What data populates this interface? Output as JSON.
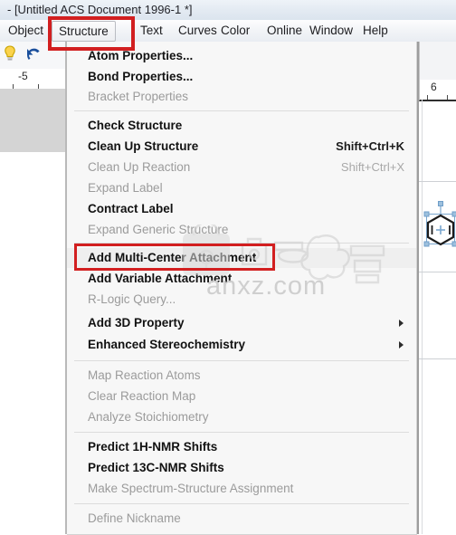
{
  "window": {
    "title": "- [Untitled ACS Document 1996-1 *]"
  },
  "menubar": {
    "items": [
      {
        "label": "Object",
        "active": false
      },
      {
        "label": "Structure",
        "active": true
      },
      {
        "label": "Text",
        "active": false
      },
      {
        "label": "Curves",
        "active": false
      },
      {
        "label": "Color",
        "active": false
      },
      {
        "label": "Online",
        "active": false
      },
      {
        "label": "Window",
        "active": false
      },
      {
        "label": "Help",
        "active": false
      }
    ]
  },
  "toolbar": {
    "lightbulb_icon": "lightbulb-icon",
    "undo_icon": "undo-icon"
  },
  "rulers": {
    "left_value": "-5",
    "right_value": "6"
  },
  "canvas": {
    "structure_name": "benzene-ring"
  },
  "dropdown": {
    "owner": "Structure",
    "items": [
      {
        "label": "Atom Properties...",
        "enabled": true,
        "accel": "",
        "submenu": false
      },
      {
        "label": "Bond Properties...",
        "enabled": true,
        "accel": "",
        "submenu": false
      },
      {
        "label": "Bracket Properties",
        "enabled": false,
        "accel": "",
        "submenu": false
      },
      {
        "separator": true
      },
      {
        "label": "Check Structure",
        "enabled": true,
        "accel": "",
        "submenu": false
      },
      {
        "label": "Clean Up Structure",
        "enabled": true,
        "accel": "Shift+Ctrl+K",
        "submenu": false
      },
      {
        "label": "Clean Up Reaction",
        "enabled": false,
        "accel": "Shift+Ctrl+X",
        "submenu": false
      },
      {
        "label": "Expand Label",
        "enabled": false,
        "accel": "",
        "submenu": false
      },
      {
        "label": "Contract Label",
        "enabled": true,
        "accel": "",
        "submenu": false
      },
      {
        "label": "Expand Generic Structure",
        "enabled": false,
        "accel": "",
        "submenu": false
      },
      {
        "separator": true
      },
      {
        "label": "Add Multi-Center Attachment",
        "enabled": true,
        "accel": "",
        "submenu": false,
        "highlighted": true
      },
      {
        "label": "Add Variable Attachment",
        "enabled": true,
        "accel": "",
        "submenu": false
      },
      {
        "label": "R-Logic Query...",
        "enabled": false,
        "accel": "",
        "submenu": false
      },
      {
        "label": "Add 3D Property",
        "enabled": true,
        "accel": "",
        "submenu": true
      },
      {
        "label": "Enhanced Stereochemistry",
        "enabled": true,
        "accel": "",
        "submenu": true
      },
      {
        "separator": true
      },
      {
        "label": "Map Reaction Atoms",
        "enabled": false,
        "accel": "",
        "submenu": false
      },
      {
        "label": "Clear Reaction Map",
        "enabled": false,
        "accel": "",
        "submenu": false
      },
      {
        "label": "Analyze Stoichiometry",
        "enabled": false,
        "accel": "",
        "submenu": false
      },
      {
        "separator": true
      },
      {
        "label": "Predict 1H-NMR Shifts",
        "enabled": true,
        "accel": "",
        "submenu": false
      },
      {
        "label": "Predict 13C-NMR Shifts",
        "enabled": true,
        "accel": "",
        "submenu": false
      },
      {
        "label": "Make Spectrum-Structure Assignment",
        "enabled": false,
        "accel": "",
        "submenu": false
      },
      {
        "separator": true
      },
      {
        "label": "Define Nickname",
        "enabled": false,
        "accel": "",
        "submenu": false
      }
    ]
  },
  "watermark": {
    "text": "anxz.com"
  },
  "annotations": {
    "accent_color": "#d21f20",
    "boxes": [
      {
        "target": "Structure"
      },
      {
        "target": "Add Multi-Center Attachment"
      }
    ]
  }
}
